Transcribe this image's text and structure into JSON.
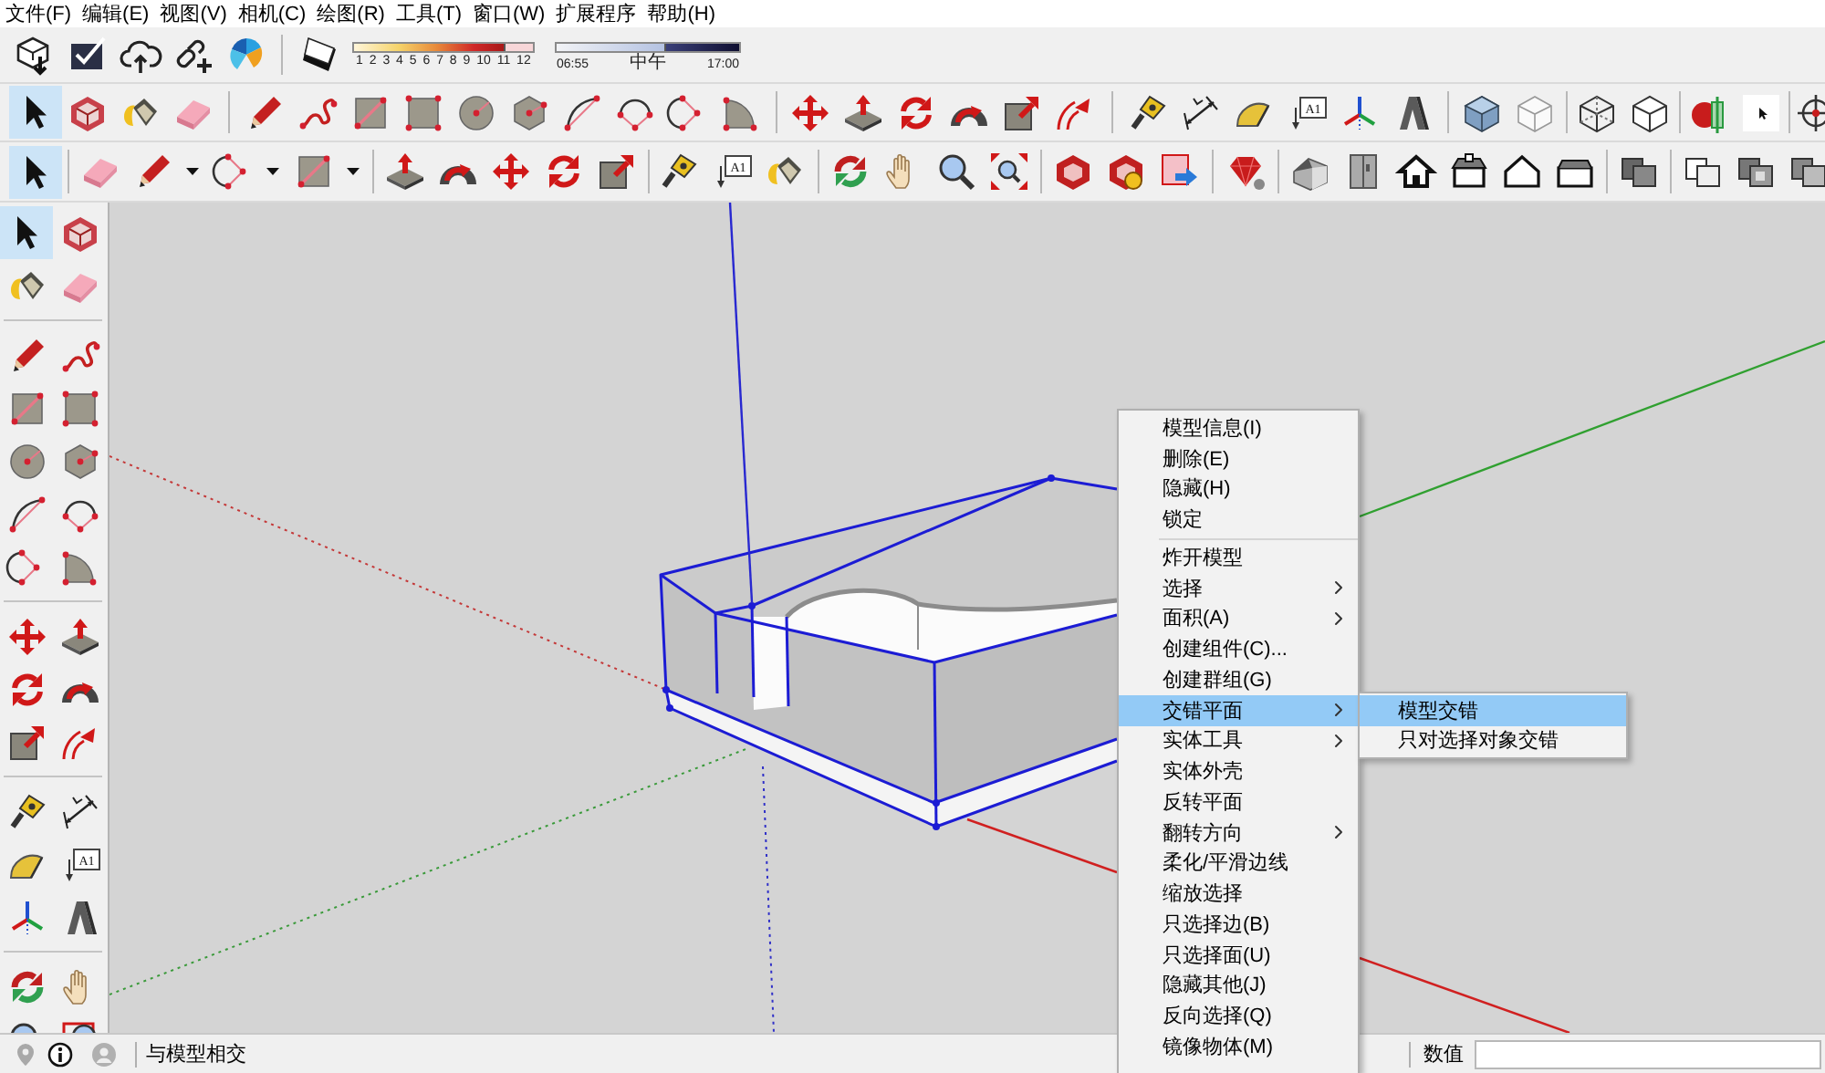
{
  "menu_bar": [
    "文件(F)",
    "编辑(E)",
    "视图(V)",
    "相机(C)",
    "绘图(R)",
    "工具(T)",
    "窗口(W)",
    "扩展程序",
    "帮助(H)"
  ],
  "shadows_toolbar": {
    "date_slider": {
      "level": 0.85,
      "labels": [
        "1",
        "2",
        "3",
        "4",
        "5",
        "6",
        "7",
        "8",
        "9",
        "10",
        "11",
        "12"
      ]
    },
    "time_slider": {
      "level": 0.6,
      "labels": [
        "06:55",
        "中午",
        "17:00"
      ]
    }
  },
  "upper_toolbar": [
    {
      "selected": true
    },
    {
      "selected": false
    },
    {
      "selected": false
    },
    {
      "selected": false
    },
    {
      "selected": false
    },
    {
      "selected": false
    },
    {
      "selected": false
    },
    {
      "selected": false
    },
    {
      "selected": false
    },
    {
      "selected": false
    },
    {
      "selected": false
    },
    {
      "selected": false
    },
    {
      "selected": false
    },
    {
      "selected": false
    },
    {
      "selected": false
    },
    {
      "selected": false
    },
    {
      "selected": false
    },
    {
      "selected": false
    },
    {
      "selected": false
    },
    {
      "selected": false
    },
    {
      "selected": false
    },
    {
      "selected": false
    },
    {
      "selected": false
    },
    {
      "selected": false,
      "label": "A1"
    },
    {
      "selected": false
    },
    {
      "selected": false
    },
    {
      "selected": false
    },
    {
      "selected": false
    },
    {
      "selected": false
    },
    {
      "selected": false
    },
    {
      "selected": false
    },
    {
      "selected": false
    },
    {
      "selected": false
    }
  ],
  "lower_toolbar": [
    {
      "selected": true
    },
    {
      "selected": false
    },
    {
      "selected": false
    },
    {
      "selected": false
    },
    {
      "selected": false
    },
    {
      "selected": false
    },
    {
      "selected": false
    },
    {
      "selected": false
    },
    {
      "selected": false
    },
    {
      "selected": false
    },
    {
      "selected": false
    },
    {
      "selected": false,
      "label": "A1"
    },
    {
      "selected": false
    },
    {
      "selected": false
    },
    {
      "selected": false
    },
    {
      "selected": false
    },
    {
      "selected": false
    },
    {
      "selected": false
    },
    {
      "selected": false
    },
    {
      "selected": false
    },
    {
      "selected": false
    },
    {
      "selected": false
    },
    {
      "selected": false
    },
    {
      "selected": false
    },
    {
      "selected": false
    },
    {
      "selected": false
    },
    {
      "selected": false
    },
    {
      "selected": false
    },
    {
      "selected": false
    },
    {
      "selected": false
    },
    {
      "selected": false
    }
  ],
  "side_toolbar": [
    {
      "selected": true
    },
    {
      "selected": false
    },
    {
      "selected": false
    },
    {
      "selected": false
    },
    {
      "selected": false
    },
    {
      "selected": false
    },
    {
      "selected": false
    },
    {
      "selected": false
    },
    {
      "selected": false
    },
    {
      "selected": false
    },
    {
      "selected": false
    },
    {
      "selected": false
    },
    {
      "selected": false
    },
    {
      "selected": false
    },
    {
      "selected": false
    },
    {
      "selected": false
    },
    {
      "selected": false
    },
    {
      "selected": false
    },
    {
      "selected": false
    },
    {
      "selected": false
    },
    {
      "selected": false
    },
    {
      "selected": false
    },
    {
      "selected": false
    },
    {
      "selected": false,
      "label": "A1"
    },
    {
      "selected": false
    },
    {
      "selected": false
    },
    {
      "selected": false
    },
    {
      "selected": false
    },
    {
      "selected": false
    },
    {
      "selected": false
    }
  ],
  "context_menu": {
    "sections": [
      {
        "items": [
          {
            "label": "模型信息(I)",
            "has_submenu": false,
            "selected": false
          },
          {
            "label": "删除(E)",
            "has_submenu": false,
            "selected": false
          },
          {
            "label": "隐藏(H)",
            "has_submenu": false,
            "selected": false
          },
          {
            "label": "锁定",
            "has_submenu": false,
            "selected": false
          }
        ]
      },
      {
        "items": [
          {
            "label": "炸开模型",
            "has_submenu": false,
            "selected": false
          },
          {
            "label": "选择",
            "has_submenu": true,
            "selected": false
          },
          {
            "label": "面积(A)",
            "has_submenu": true,
            "selected": false
          },
          {
            "label": "创建组件(C)...",
            "has_submenu": false,
            "selected": false
          },
          {
            "label": "创建群组(G)",
            "has_submenu": false,
            "selected": false
          },
          {
            "label": "交错平面",
            "has_submenu": true,
            "selected": true,
            "submenu": [
              {
                "label": "模型交错",
                "selected": true
              },
              {
                "label": "只对选择对象交错",
                "selected": false
              }
            ]
          },
          {
            "label": "实体工具",
            "has_submenu": true,
            "selected": false
          },
          {
            "label": "实体外壳",
            "has_submenu": false,
            "selected": false
          },
          {
            "label": "反转平面",
            "has_submenu": false,
            "selected": false
          },
          {
            "label": "翻转方向",
            "has_submenu": true,
            "selected": false
          },
          {
            "label": "柔化/平滑边线",
            "has_submenu": false,
            "selected": false
          },
          {
            "label": "缩放选择",
            "has_submenu": false,
            "selected": false
          },
          {
            "label": "只选择边(B)",
            "has_submenu": false,
            "selected": false
          },
          {
            "label": "只选择面(U)",
            "has_submenu": false,
            "selected": false
          },
          {
            "label": "隐藏其他(J)",
            "has_submenu": false,
            "selected": false
          },
          {
            "label": "反向选择(Q)",
            "has_submenu": false,
            "selected": false
          },
          {
            "label": "镜像物体(M)",
            "has_submenu": false,
            "selected": false
          }
        ]
      }
    ]
  },
  "status_bar": {
    "message": "与模型相交",
    "measurements_label": "数值"
  }
}
